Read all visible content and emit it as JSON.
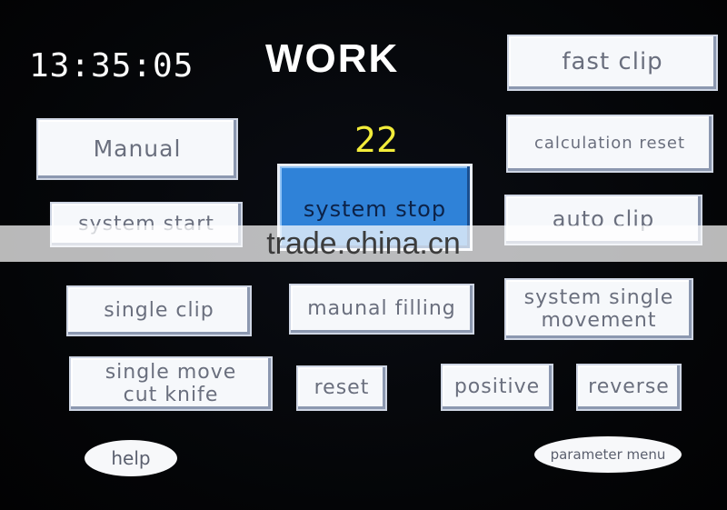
{
  "header": {
    "clock": "13:35:05",
    "title": "WORK",
    "counter": "22"
  },
  "buttons": {
    "fast_clip": "fast clip",
    "manual": "Manual",
    "calculation_reset": "calculation reset",
    "system_stop": "system stop",
    "auto_clip": "auto clip",
    "system_start": "system start",
    "single_clip": "single clip",
    "maunal_filling": "maunal filling",
    "system_single_movement_line1": "system single",
    "system_single_movement_line2": "movement",
    "single_move_cut_knife_line1": "single move",
    "single_move_cut_knife_line2": "cut knife",
    "reset": "reset",
    "positive": "positive",
    "reverse": "reverse",
    "help": "help",
    "parameter_menu": "parameter menu"
  },
  "watermark": "trade.china.cn",
  "colors": {
    "background": "#050608",
    "button_face": "#f6f8fb",
    "button_text": "#6a6f7e",
    "active_button": "#2f82d8",
    "counter": "#f2ec3a"
  }
}
